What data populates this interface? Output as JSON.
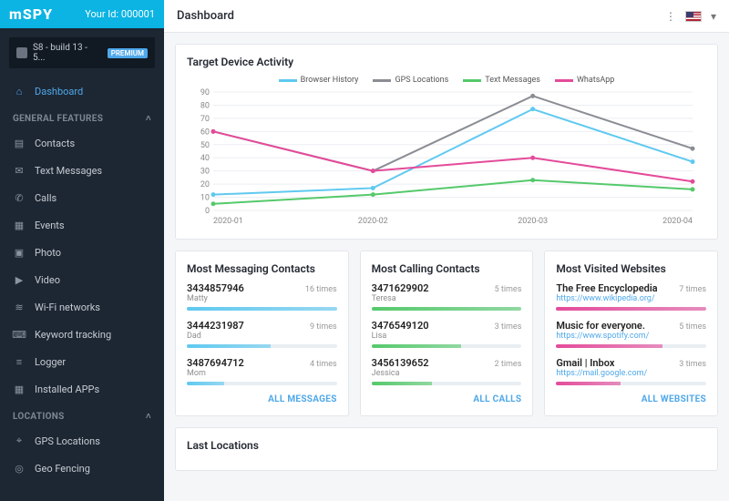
{
  "brand": "mSPY",
  "user_id_label": "Your Id:",
  "user_id": "000001",
  "device": {
    "name": "S8 - build 13 - 5...",
    "badge": "PREMIUM"
  },
  "sidebar": {
    "dashboard": "Dashboard",
    "general_header": "GENERAL FEATURES",
    "general": [
      {
        "label": "Contacts",
        "icon": "contacts"
      },
      {
        "label": "Text Messages",
        "icon": "message"
      },
      {
        "label": "Calls",
        "icon": "call"
      },
      {
        "label": "Events",
        "icon": "calendar"
      },
      {
        "label": "Photo",
        "icon": "photo"
      },
      {
        "label": "Video",
        "icon": "video"
      },
      {
        "label": "Wi-Fi networks",
        "icon": "wifi"
      },
      {
        "label": "Keyword tracking",
        "icon": "keyboard"
      },
      {
        "label": "Logger",
        "icon": "logger"
      },
      {
        "label": "Installed APPs",
        "icon": "apps"
      }
    ],
    "locations_header": "LOCATIONS",
    "locations": [
      {
        "label": "GPS Locations",
        "icon": "pin"
      },
      {
        "label": "Geo Fencing",
        "icon": "geo"
      }
    ]
  },
  "header": {
    "title": "Dashboard"
  },
  "chart_title": "Target Device Activity",
  "chart_data": {
    "type": "line",
    "categories": [
      "2020-01",
      "2020-02",
      "2020-03",
      "2020-04"
    ],
    "ylim": [
      0,
      90
    ],
    "yticks": [
      0,
      10,
      20,
      30,
      40,
      50,
      60,
      70,
      80,
      90
    ],
    "series": [
      {
        "name": "Browser History",
        "color": "#5fc9f0",
        "values": [
          12,
          17,
          77,
          37
        ]
      },
      {
        "name": "GPS Locations",
        "color": "#8a8d93",
        "values": [
          60,
          30,
          87,
          47
        ]
      },
      {
        "name": "Text Messages",
        "color": "#55c96b",
        "values": [
          5,
          12,
          23,
          16
        ]
      },
      {
        "name": "WhatsApp",
        "color": "#e44b9a",
        "values": [
          60,
          30,
          40,
          22
        ]
      }
    ]
  },
  "cards": {
    "msg": {
      "title": "Most Messaging Contacts",
      "suffix": " times",
      "color": "#5fc9f0",
      "all": "ALL MESSAGES",
      "items": [
        {
          "num": "3434857946",
          "name": "Matty",
          "count": 16,
          "pct": 100
        },
        {
          "num": "3444231987",
          "name": "Dad",
          "count": 9,
          "pct": 56
        },
        {
          "num": "3487694712",
          "name": "Mom",
          "count": 4,
          "pct": 25
        }
      ]
    },
    "call": {
      "title": "Most Calling Contacts",
      "suffix": " times",
      "color": "#55c96b",
      "all": "ALL CALLS",
      "items": [
        {
          "num": "3471629902",
          "name": "Teresa",
          "count": 5,
          "pct": 100
        },
        {
          "num": "3476549120",
          "name": "Lisa",
          "count": 3,
          "pct": 60
        },
        {
          "num": "3456139652",
          "name": "Jessica",
          "count": 2,
          "pct": 40
        }
      ]
    },
    "web": {
      "title": "Most Visited Websites",
      "suffix": " times",
      "color": "#e44b9a",
      "all": "ALL WEBSITES",
      "items": [
        {
          "num": "The Free Encyclopedia",
          "name": "https://www.wikipedia.org/",
          "count": 7,
          "pct": 100,
          "isLink": true
        },
        {
          "num": "Music for everyone.",
          "name": "https://www.spotify.com/",
          "count": 5,
          "pct": 71,
          "isLink": true
        },
        {
          "num": "Gmail | Inbox",
          "name": "https://mail.google.com/",
          "count": 3,
          "pct": 43,
          "isLink": true
        }
      ]
    }
  },
  "last_locations": "Last Locations"
}
